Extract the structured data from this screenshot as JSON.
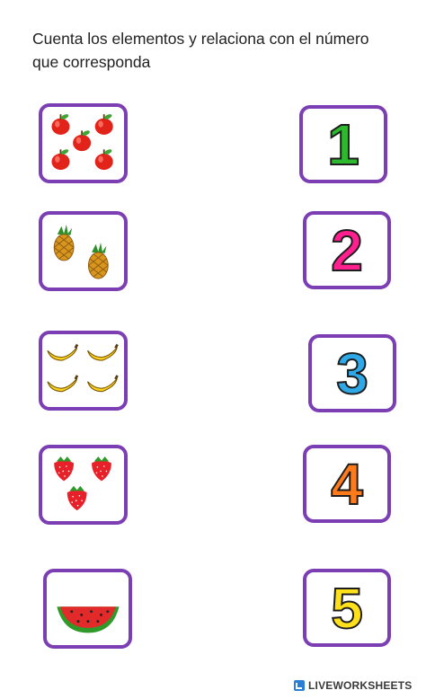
{
  "instructions": "Cuenta los elementos y relaciona con el número que corresponda",
  "fruit_boxes": [
    {
      "icon": "apple-icon",
      "count": 5
    },
    {
      "icon": "pineapple-icon",
      "count": 2
    },
    {
      "icon": "banana-icon",
      "count": 4
    },
    {
      "icon": "strawberry-icon",
      "count": 3
    },
    {
      "icon": "watermelon-icon",
      "count": 1
    }
  ],
  "numbers": [
    {
      "label": "1",
      "color": "#2db82d"
    },
    {
      "label": "2",
      "color": "#ff1f8e"
    },
    {
      "label": "3",
      "color": "#2fa8e8"
    },
    {
      "label": "4",
      "color": "#ff7a1a"
    },
    {
      "label": "5",
      "color": "#ffe01a"
    }
  ],
  "border_color": "#7b3fb3",
  "footer": {
    "brand": "LIVEWORKSHEETS"
  }
}
